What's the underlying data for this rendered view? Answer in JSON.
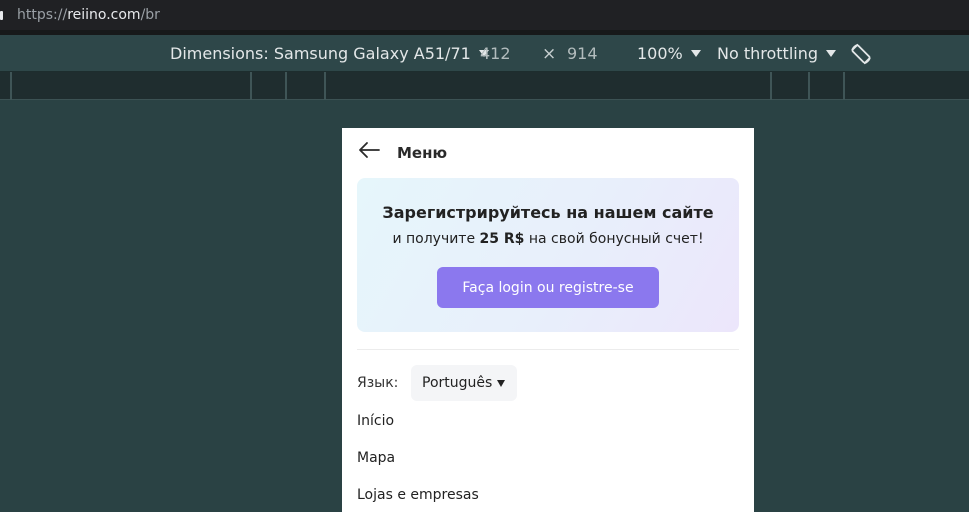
{
  "browser": {
    "url_scheme": "https://",
    "url_host": "reiino.com",
    "url_path": "/br"
  },
  "device_toolbar": {
    "dimensions_label": "Dimensions: Samsung Galaxy A51/71",
    "width": "412",
    "times": "×",
    "height": "914",
    "zoom": "100%",
    "throttling": "No throttling",
    "rotate_icon": "rotate-icon"
  },
  "page": {
    "back_icon": "arrow-left-icon",
    "menu_title": "Меню",
    "promo": {
      "title": "Зарегистрируйтесь на нашем сайте",
      "sub_before": "и получите ",
      "sub_amount": "25 R$",
      "sub_after": " на свой бонусный счет!",
      "button": "Faça login ou registre-se"
    },
    "language": {
      "label": "Язык:",
      "selected": "Português"
    },
    "nav": [
      "Início",
      "Mapa",
      "Lojas e empresas"
    ]
  },
  "colors": {
    "button_bg": "#8b78ee",
    "page_bg": "#2a4244"
  }
}
